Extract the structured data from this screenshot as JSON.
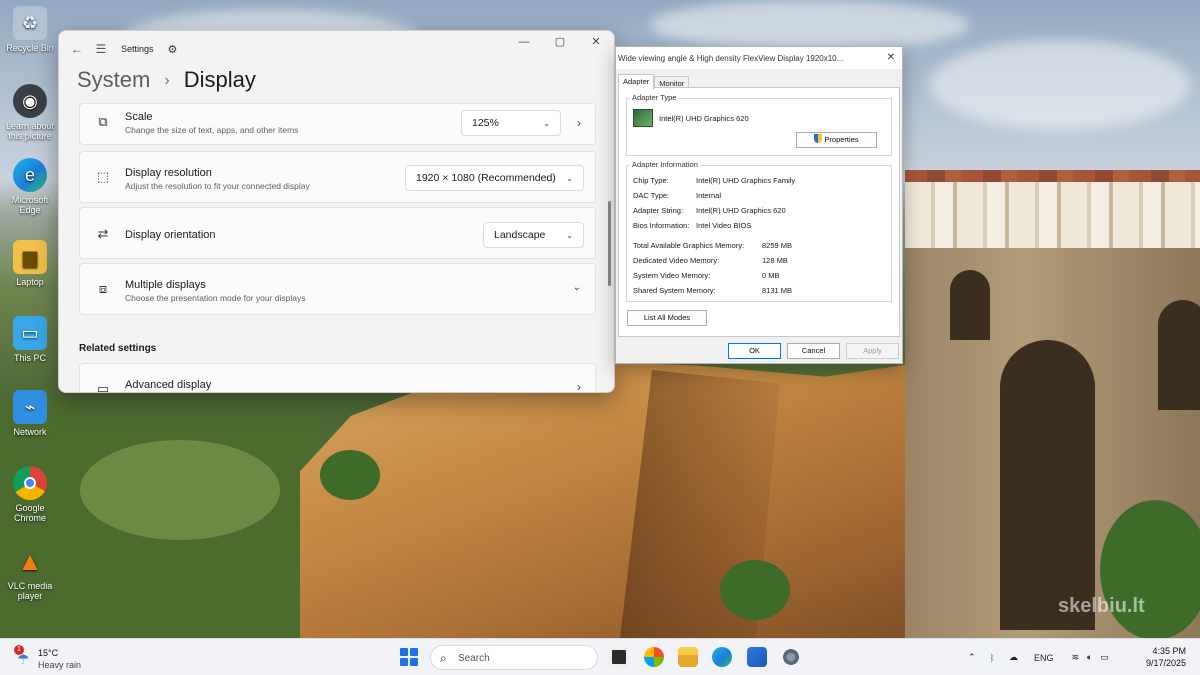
{
  "desktop_icons": [
    {
      "label": "Recycle Bin",
      "icon": "recycle-bin-icon"
    },
    {
      "label": "Learn about this picture",
      "icon": "learn-picture-icon"
    },
    {
      "label": "Microsoft Edge",
      "icon": "edge-icon"
    },
    {
      "label": "Laptop",
      "icon": "folder-user-icon"
    },
    {
      "label": "This PC",
      "icon": "monitor-icon"
    },
    {
      "label": "Network",
      "icon": "network-icon"
    },
    {
      "label": "Google Chrome",
      "icon": "chrome-icon"
    },
    {
      "label": "VLC media player",
      "icon": "vlc-icon"
    }
  ],
  "settings": {
    "app_title": "Settings",
    "breadcrumb_parent": "System",
    "breadcrumb_separator": "›",
    "page_title": "Display",
    "scale": {
      "title": "Scale",
      "subtitle": "Change the size of text, apps, and other items",
      "value": "125%"
    },
    "resolution": {
      "title": "Display resolution",
      "subtitle": "Adjust the resolution to fit your connected display",
      "value": "1920 × 1080 (Recommended)"
    },
    "orientation": {
      "title": "Display orientation",
      "value": "Landscape"
    },
    "multiple": {
      "title": "Multiple displays",
      "subtitle": "Choose the presentation mode for your displays"
    },
    "related_label": "Related settings",
    "advanced": {
      "title": "Advanced display"
    }
  },
  "dialog": {
    "title": "Wide viewing angle & High density FlexView Display 1920x10...",
    "tabs": [
      "Adapter",
      "Monitor"
    ],
    "adapter_type_label": "Adapter Type",
    "adapter_name": "Intel(R) UHD Graphics 620",
    "properties_button": "Properties",
    "adapter_info_label": "Adapter Information",
    "info": [
      {
        "key": "Chip Type:",
        "value": "Intel(R) UHD Graphics Family"
      },
      {
        "key": "DAC Type:",
        "value": "Internal"
      },
      {
        "key": "Adapter String:",
        "value": "Intel(R) UHD Graphics 620"
      },
      {
        "key": "Bios Information:",
        "value": "Intel Video BIOS"
      }
    ],
    "memory": [
      {
        "key": "Total Available Graphics Memory:",
        "value": "8259 MB"
      },
      {
        "key": "Dedicated Video Memory:",
        "value": "128 MB"
      },
      {
        "key": "System Video Memory:",
        "value": "0 MB"
      },
      {
        "key": "Shared System Memory:",
        "value": "8131 MB"
      }
    ],
    "list_modes_button": "List All Modes",
    "ok_button": "OK",
    "cancel_button": "Cancel",
    "apply_button": "Apply"
  },
  "taskbar": {
    "weather_temp": "15°C",
    "weather_desc": "Heavy rain",
    "weather_badge": "1",
    "search_placeholder": "Search",
    "language": "ENG",
    "time": "4:35 PM",
    "date": "9/17/2025"
  },
  "watermark": "skelbiu.lt",
  "colors": {
    "accent": "#0078d4",
    "taskbar_bg": "#f1f3f7"
  }
}
